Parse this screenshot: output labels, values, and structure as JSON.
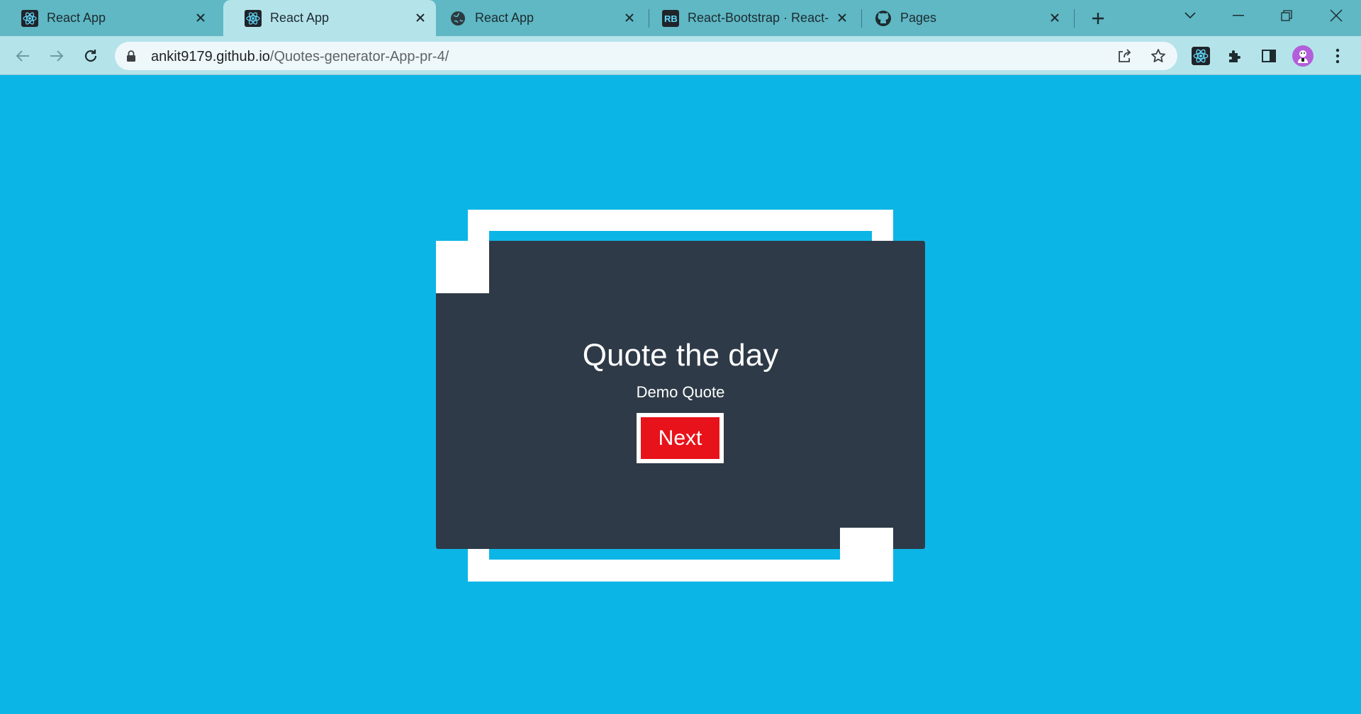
{
  "tabs": [
    {
      "title": "React App",
      "icon": "react-icon",
      "active": false
    },
    {
      "title": "React App",
      "icon": "react-icon",
      "active": true
    },
    {
      "title": "React App",
      "icon": "globe-icon",
      "active": false
    },
    {
      "title": "React-Bootstrap · React-B",
      "icon": "react-bootstrap-icon",
      "active": false
    },
    {
      "title": "Pages",
      "icon": "github-icon",
      "active": false
    }
  ],
  "address_bar": {
    "domain": "ankit9179.github.io",
    "path": "/Quotes-generator-App-pr-4/"
  },
  "page": {
    "title": "Quote the day",
    "quote": "Demo Quote",
    "next_label": "Next"
  },
  "colors": {
    "page_background": "#0bb5e6",
    "card_background": "#2e3a47",
    "button_red": "#e8131a",
    "frame_white": "#ffffff"
  }
}
